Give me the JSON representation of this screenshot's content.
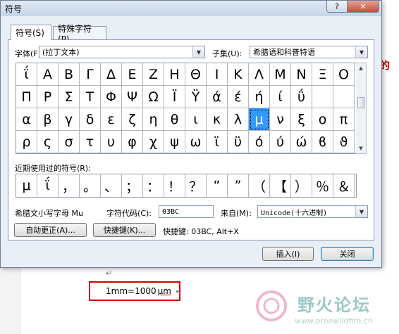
{
  "dialog": {
    "title": "符号",
    "help_label": "?",
    "close_glyph": "✕",
    "tabs": [
      "符号(S)",
      "特殊字符(P)"
    ],
    "font_label": "字体(F):",
    "font_value": "(拉丁文本)",
    "subset_label": "子集(U):",
    "subset_value": "希腊语和科普特语",
    "grid": [
      [
        "ΐ",
        "Α",
        "Β",
        "Γ",
        "Δ",
        "Ε",
        "Ζ",
        "Η",
        "Θ",
        "Ι",
        "Κ",
        "Λ",
        "Μ",
        "Ν",
        "Ξ",
        "Ο"
      ],
      [
        "Π",
        "Ρ",
        "Σ",
        "Τ",
        "Φ",
        "Ψ",
        "Ω",
        "Ϊ",
        "Ϋ",
        "ά",
        "έ",
        "ή",
        "ί",
        "ΰ"
      ],
      [
        "α",
        "β",
        "γ",
        "δ",
        "ε",
        "ζ",
        "η",
        "θ",
        "ι",
        "κ",
        "λ",
        "μ",
        "ν",
        "ξ",
        "ο",
        "π"
      ],
      [
        "ρ",
        "ς",
        "σ",
        "τ",
        "υ",
        "φ",
        "χ",
        "ψ",
        "ω",
        "ϊ",
        "ϋ",
        "ό",
        "ύ",
        "ώ",
        "ϐ",
        "ϑ"
      ]
    ],
    "selected_symbol": "μ",
    "recent_label": "近期使用过的符号(R):",
    "recent": [
      "μ",
      "ΐ",
      "，",
      "。",
      "、",
      "；",
      "：",
      "！",
      "？",
      "“",
      "”",
      "（",
      "【",
      "）",
      "％",
      "＆"
    ],
    "char_name": "希腊文小写字母 Mu",
    "char_code_label": "字符代码(C):",
    "char_code": "03BC",
    "from_label": "来自(M):",
    "from_value": "Unicode(十六进制)",
    "autocorrect_button": "自动更正(A)...",
    "shortcut_button": "快捷键(K)...",
    "shortcut_text": "快捷键: 03BC, Alt+X",
    "insert_button": "插入(I)",
    "close_button": "关闭"
  },
  "document": {
    "red_text": "的",
    "formula": "1mm=1000",
    "unit": "μm",
    "paragraph_mark": "↵",
    "line_arrow": "↵",
    "watermark_text": "野火论坛",
    "watermark_url": "www.proewildfire.cn"
  },
  "colors": {
    "selection": "#3399ff",
    "highlight_box": "#d40000",
    "watermark": "#79b7b3"
  }
}
